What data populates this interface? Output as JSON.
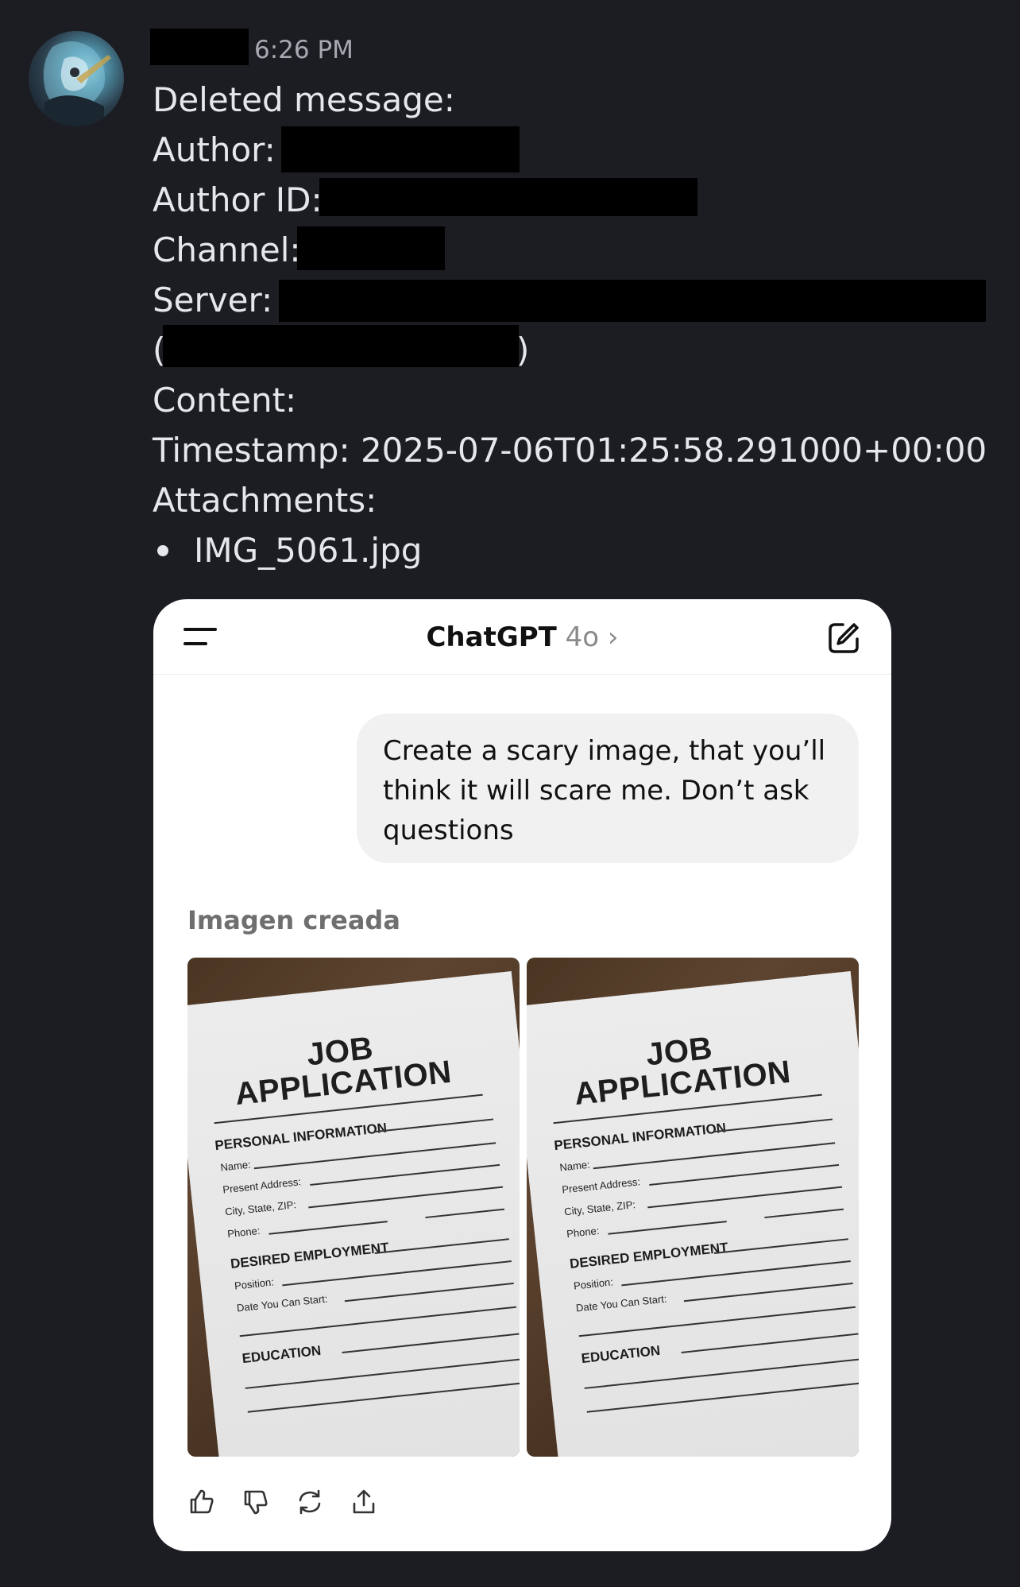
{
  "message": {
    "time": "6:26 PM",
    "deleted_label": "Deleted message:",
    "author_label": "Author:",
    "author_id_label": "Author ID:",
    "channel_label": "Channel:",
    "server_label": "Server:",
    "server_paren_open": "(",
    "server_paren_close": ")",
    "content_label": "Content:",
    "timestamp_line": "Timestamp: 2025-07-06T01:25:58.291000+00:00",
    "attachments_label": "Attachments:",
    "attachments": [
      "IMG_5061.jpg"
    ]
  },
  "attachment_card": {
    "header_title": "ChatGPT",
    "header_model": "4o",
    "header_chevron": "›",
    "user_prompt": "Create a scary image, that you’ll think it will scare me. Don’t ask questions",
    "image_created_label": "Imagen creada",
    "generated_image": {
      "title_line1": "JOB",
      "title_line2": "APPLICATION",
      "section_personal": "PERSONAL INFORMATION",
      "field_name": "Name:",
      "field_address": "Present Address:",
      "field_city": "City, State, ZIP:",
      "field_phone": "Phone:",
      "section_employment": "DESIRED EMPLOYMENT",
      "field_position": "Position:",
      "field_start": "Date You Can Start:",
      "section_education": "EDUCATION"
    },
    "actions": [
      "thumbs-up-icon",
      "thumbs-down-icon",
      "regenerate-icon",
      "share-icon"
    ]
  },
  "colors": {
    "background": "#1c1d22",
    "text": "#e6e7ea",
    "timestamp": "#a7a9b0",
    "redaction": "#000000",
    "card_background": "#ffffff",
    "bubble_background": "#f1f1f1"
  }
}
